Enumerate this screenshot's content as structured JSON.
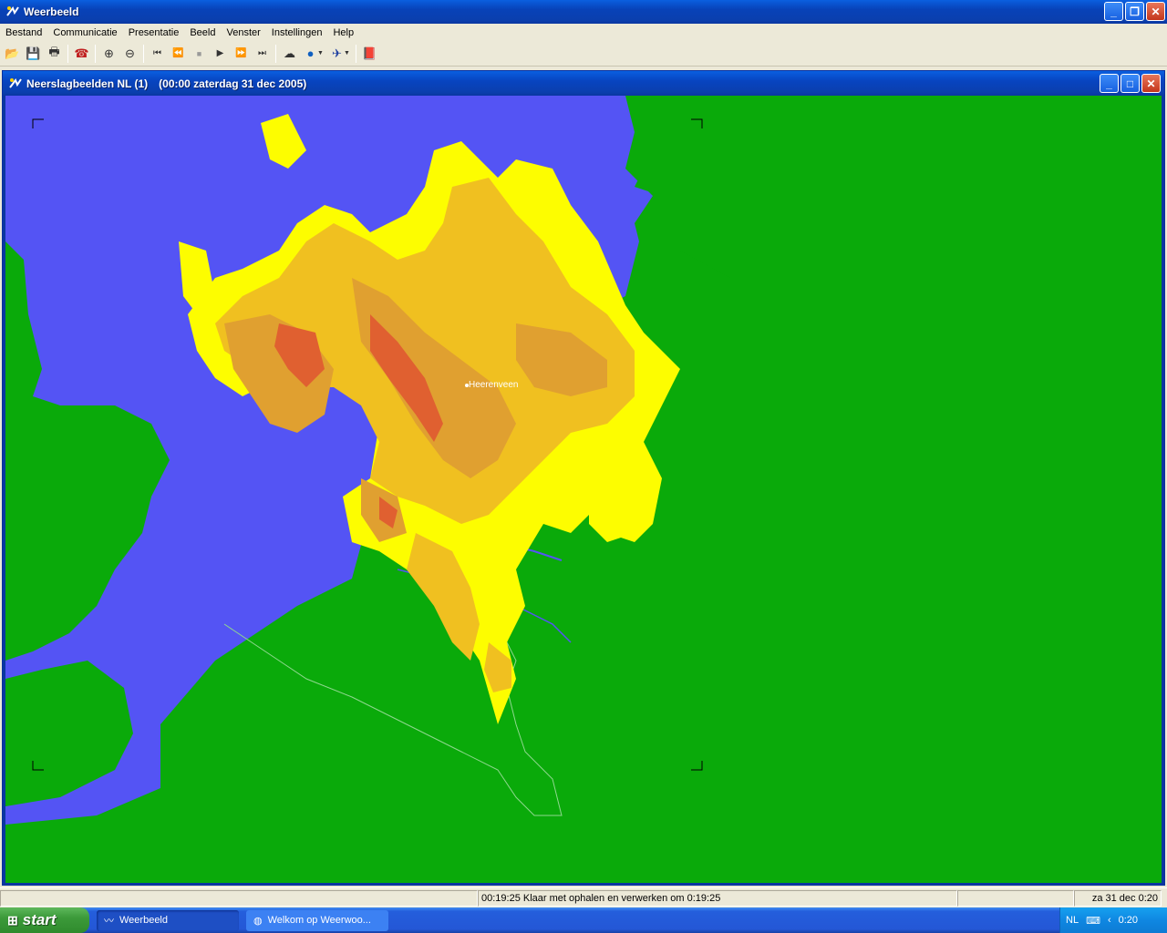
{
  "app": {
    "title": "Weerbeeld"
  },
  "menu": [
    "Bestand",
    "Communicatie",
    "Presentatie",
    "Beeld",
    "Venster",
    "Instellingen",
    "Help"
  ],
  "toolbar": {
    "icons": [
      "open-folder-icon",
      "save-icon",
      "print-icon",
      "connect-phone-icon",
      "zoom-in-icon",
      "zoom-out-icon",
      "first-frame-icon",
      "previous-frame-icon",
      "stop-icon",
      "play-icon",
      "next-frame-icon",
      "last-frame-icon",
      "weather-icon",
      "globe-icon",
      "satellite-icon",
      "book-icon"
    ]
  },
  "child_window": {
    "title": "Neerslagbeelden NL (1)",
    "subtitle": "(00:00 zaterdag 31 dec 2005)"
  },
  "map": {
    "place_label": "Heerenveen",
    "colors": {
      "sea": "#5454f4",
      "land": "#0aaa0a",
      "rain_light": "#fdfd00",
      "rain_medium": "#f0c020",
      "rain_heavy": "#e0a030",
      "rain_intense": "#e06030"
    }
  },
  "status": {
    "message": "00:19:25 Klaar met ophalen en verwerken om 0:19:25",
    "datetime": "za 31 dec 0:20"
  },
  "taskbar": {
    "start_label": "start",
    "items": [
      "Weerbeeld",
      "Welkom op Weerwoo..."
    ],
    "tray_lang": "NL",
    "clock": "0:20"
  }
}
